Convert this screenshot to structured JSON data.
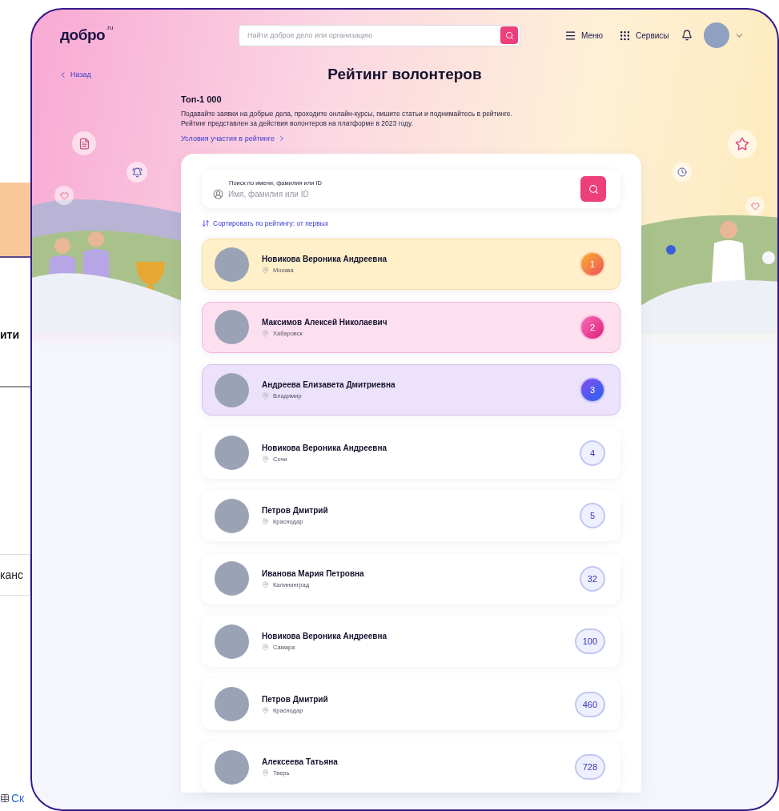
{
  "backdrop": {
    "texts": [
      "ити",
      "канс",
      "Ск"
    ]
  },
  "header": {
    "logo": "добро",
    "logo_suffix": ".ru",
    "search_placeholder": "Найти доброе дело или организацию",
    "menu": "Меню",
    "services": "Сервисы"
  },
  "back": "Назад",
  "title": "Рейтинг волонтеров",
  "subtitle": "Топ-1 000",
  "description": [
    "Подавайте заявки на добрые дела, проходите онлайн-курсы, пишите статьи и поднимайтесь в рейтинге.",
    "Рейтинг представлен за действия волонтеров на платформе в 2023 году."
  ],
  "conditions_link": "Условия участия в рейтинге",
  "search": {
    "label": "Поиск по имени, фамилия или ID",
    "placeholder": "Имя, фамилия или ID"
  },
  "sort": "Сортировать по рейтингу: от первых",
  "volunteers": [
    {
      "name": "Новикова Вероника Андреевна",
      "city": "Москва",
      "rank": "1",
      "kind": "gold"
    },
    {
      "name": "Максимов Алексей Николаевич",
      "city": "Хабаровск",
      "rank": "2",
      "kind": "pink"
    },
    {
      "name": "Андреева Елизавета Дмитриевна",
      "city": "Владимир",
      "rank": "3",
      "kind": "violet"
    },
    {
      "name": "Новикова Вероника Андреевна",
      "city": "Сочи",
      "rank": "4",
      "kind": "plain"
    },
    {
      "name": "Петров Дмитрий",
      "city": "Краснодар",
      "rank": "5",
      "kind": "plain"
    },
    {
      "name": "Иванова Мария Петровна",
      "city": "Калининград",
      "rank": "32",
      "kind": "plain"
    },
    {
      "name": "Новикова Вероника Андреевна",
      "city": "Самара",
      "rank": "100",
      "kind": "plain"
    },
    {
      "name": "Петров Дмитрий",
      "city": "Краснодар",
      "rank": "460",
      "kind": "plain"
    },
    {
      "name": "Алексеева Татьяна",
      "city": "Тверь",
      "rank": "728",
      "kind": "plain"
    }
  ]
}
